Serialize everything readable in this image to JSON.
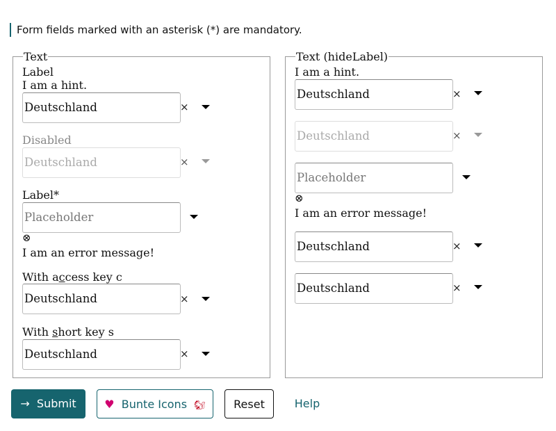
{
  "note": "Form fields marked with an asterisk (*) are mandatory.",
  "left": {
    "legend": "Text",
    "f1": {
      "label": "Label",
      "hint": "I am a hint.",
      "value": "Deutschland"
    },
    "f2": {
      "label": "Disabled",
      "value": "Deutschland"
    },
    "f3": {
      "label": "Label*",
      "placeholder": "Placeholder",
      "error": "I am an error message!"
    },
    "f4": {
      "label_a": "With a",
      "label_u": "c",
      "label_b": "cess key c",
      "value": "Deutschland"
    },
    "f5": {
      "label_a": "With ",
      "label_u": "s",
      "label_b": "hort key s",
      "value": "Deutschland"
    }
  },
  "right": {
    "legend": "Text (hideLabel)",
    "f1": {
      "hint": "I am a hint.",
      "value": "Deutschland"
    },
    "f2": {
      "value": "Deutschland"
    },
    "f3": {
      "placeholder": "Placeholder",
      "error": "I am an error message!"
    },
    "f4": {
      "value": "Deutschland"
    },
    "f5": {
      "value": "Deutschland"
    }
  },
  "icons": {
    "clear": "×",
    "error": "⊗",
    "submit": "→",
    "heart": "♥",
    "squirrel": "🐿"
  },
  "buttons": {
    "submit": "Submit",
    "bunte": "Bunte Icons",
    "reset": "Reset",
    "help": "Help"
  },
  "colors": {
    "accent": "#16646e",
    "heart": "#d0006f",
    "squirrel": "#c0001a"
  }
}
